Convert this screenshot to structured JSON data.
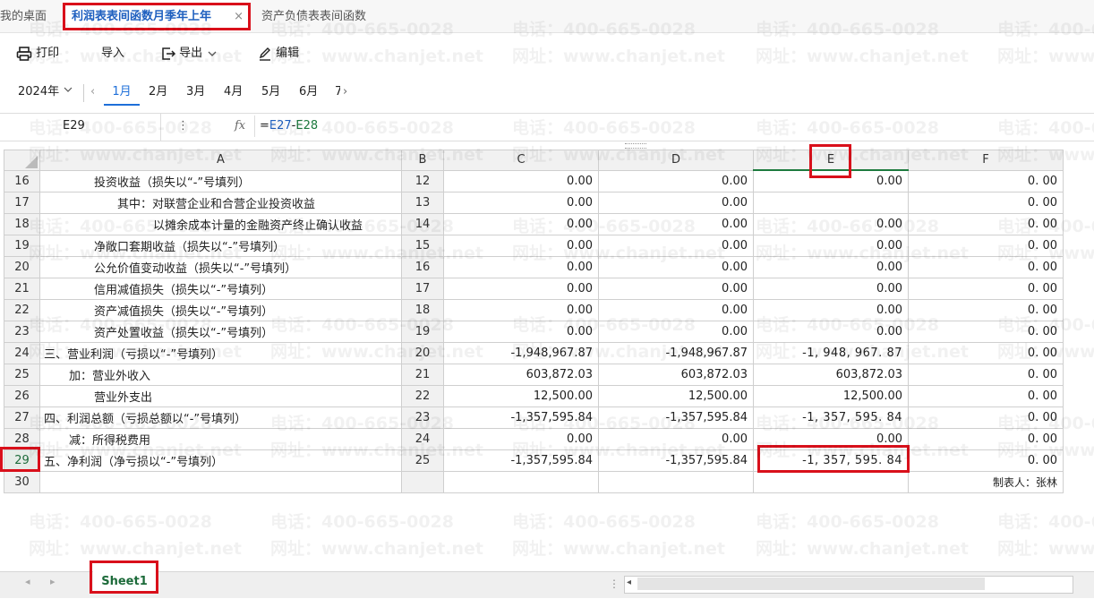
{
  "tabs": [
    {
      "label": "我的桌面"
    },
    {
      "label": "利润表表间函数月季年上年",
      "close": "×"
    },
    {
      "label": "资产负债表表间函数"
    }
  ],
  "toolbar": {
    "print": "打印",
    "import": "导入",
    "export": "导出",
    "edit": "编辑"
  },
  "period": {
    "year": "2024年",
    "months": [
      "1月",
      "2月",
      "3月",
      "4月",
      "5月",
      "6月",
      "7"
    ],
    "active_month": "1月"
  },
  "formula_bar": {
    "cell_ref": "E29",
    "fx": "fx",
    "formula_prefix": "=",
    "ref1": "E27",
    "op": "-",
    "ref2": "E28"
  },
  "grid": {
    "columns": [
      "A",
      "B",
      "C",
      "D",
      "E",
      "F"
    ],
    "selected_column": "E",
    "rows": [
      {
        "num": "16",
        "a": "投资收益（损失以“-”号填列）",
        "b": "12",
        "c": "0.00",
        "d": "0.00",
        "e": "0.00",
        "f": "0. 00"
      },
      {
        "num": "17",
        "a": "其中：对联营企业和合营企业投资收益",
        "b": "13",
        "c": "0.00",
        "d": "0.00",
        "e": "",
        "f": "0. 00"
      },
      {
        "num": "18",
        "a": "以摊余成本计量的金融资产终止确认收益",
        "b": "14",
        "c": "0.00",
        "d": "0.00",
        "e": "0.00",
        "f": "0. 00"
      },
      {
        "num": "19",
        "a": "净敞口套期收益（损失以“-”号填列）",
        "b": "15",
        "c": "0.00",
        "d": "0.00",
        "e": "0.00",
        "f": "0. 00"
      },
      {
        "num": "20",
        "a": "公允价值变动收益（损失以“-”号填列）",
        "b": "16",
        "c": "0.00",
        "d": "0.00",
        "e": "0.00",
        "f": "0. 00"
      },
      {
        "num": "21",
        "a": "信用减值损失（损失以“-”号填列）",
        "b": "17",
        "c": "0.00",
        "d": "0.00",
        "e": "0.00",
        "f": "0. 00"
      },
      {
        "num": "22",
        "a": "资产减值损失（损失以“-”号填列）",
        "b": "18",
        "c": "0.00",
        "d": "0.00",
        "e": "0.00",
        "f": "0. 00"
      },
      {
        "num": "23",
        "a": "资产处置收益（损失以“-”号填列）",
        "b": "19",
        "c": "0.00",
        "d": "0.00",
        "e": "0.00",
        "f": "0. 00"
      },
      {
        "num": "24",
        "a": "三、营业利润（亏损以“-”号填列）",
        "b": "20",
        "c": "-1,948,967.87",
        "d": "-1,948,967.87",
        "e": "-1, 948, 967. 87",
        "f": "0. 00"
      },
      {
        "num": "25",
        "a": "加：营业外收入",
        "b": "21",
        "c": "603,872.03",
        "d": "603,872.03",
        "e": "603,872.03",
        "f": "0. 00"
      },
      {
        "num": "26",
        "a": "营业外支出",
        "b": "22",
        "c": "12,500.00",
        "d": "12,500.00",
        "e": "12,500.00",
        "f": "0. 00"
      },
      {
        "num": "27",
        "a": "四、利润总额（亏损总额以“-”号填列）",
        "b": "23",
        "c": "-1,357,595.84",
        "d": "-1,357,595.84",
        "e": "-1, 357, 595. 84",
        "f": "0. 00"
      },
      {
        "num": "28",
        "a": "减：所得税费用",
        "b": "24",
        "c": "0.00",
        "d": "0.00",
        "e": "0.00",
        "f": "0. 00"
      },
      {
        "num": "29",
        "a": "五、净利润（净亏损以“-”号填列）",
        "b": "25",
        "c": "-1,357,595.84",
        "d": "-1,357,595.84",
        "e": "-1, 357, 595. 84",
        "f": "0. 00"
      },
      {
        "num": "30",
        "a": "",
        "b": "",
        "c": "",
        "d": "",
        "e": "",
        "f": "制表人：张林"
      }
    ]
  },
  "watermark": {
    "phone": "电话：400-665-0028",
    "site": "网址：www.chanjet.net"
  },
  "sheet_tabs": [
    "Sheet1"
  ],
  "colors": {
    "accent": "#1e6fd9",
    "highlight_box": "#d9101b",
    "sheet_green": "#1d6b3a"
  }
}
